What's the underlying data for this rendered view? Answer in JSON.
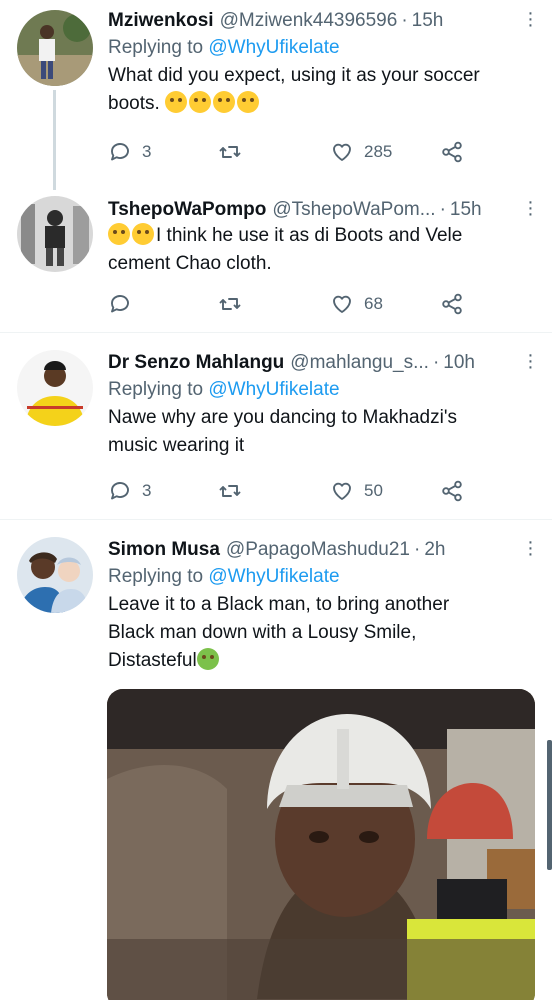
{
  "tweets": [
    {
      "display_name": "Mziwenkosi",
      "handle": "@Mziwenk44396596",
      "time": "15h",
      "replying_prefix": "Replying to",
      "replying_to": "@WhyUfikelate",
      "text": "What did you expect, using it as your soccer boots.",
      "emojis": [
        "rolling-on-floor-laughing",
        "tears-of-joy",
        "rolling-on-floor-laughing",
        "tears-of-joy"
      ],
      "replies": "3",
      "retweets": "",
      "likes": "285"
    },
    {
      "display_name": "TshepoWaPompo",
      "handle": "@TshepoWaPom...",
      "time": "15h",
      "text_line1": "I think he use it as di Boots and Vele",
      "text_line2": "cement Chao cloth.",
      "emojis": [
        "tears-of-joy",
        "tears-of-joy"
      ],
      "replies": "",
      "retweets": "",
      "likes": "68"
    },
    {
      "display_name": "Dr Senzo Mahlangu",
      "handle": "@mahlangu_s...",
      "time": "10h",
      "replying_prefix": "Replying to",
      "replying_to": "@WhyUfikelate",
      "text_line1": "Nawe why are you dancing to Makhadzi's",
      "text_line2": "music wearing it",
      "replies": "3",
      "retweets": "",
      "likes": "50"
    },
    {
      "display_name": "Simon Musa",
      "handle": "@PapagoMashudu21",
      "time": "2h",
      "replying_prefix": "Replying to",
      "replying_to": "@WhyUfikelate",
      "text_line1": "Leave it to a Black man, to bring another",
      "text_line2": "Black man down with a Lousy Smile,",
      "text_line3": "Distasteful",
      "emojis": [
        "nauseated-face"
      ],
      "media": "photo"
    }
  ],
  "icons": {
    "reply": "reply-icon",
    "retweet": "retweet-icon",
    "like": "heart-icon",
    "share": "share-icon",
    "more": "more-icon"
  },
  "colors": {
    "accent": "#1d9bf0",
    "secondary_text": "#536471",
    "primary_text": "#0f1419",
    "divider": "#eff3f4"
  }
}
